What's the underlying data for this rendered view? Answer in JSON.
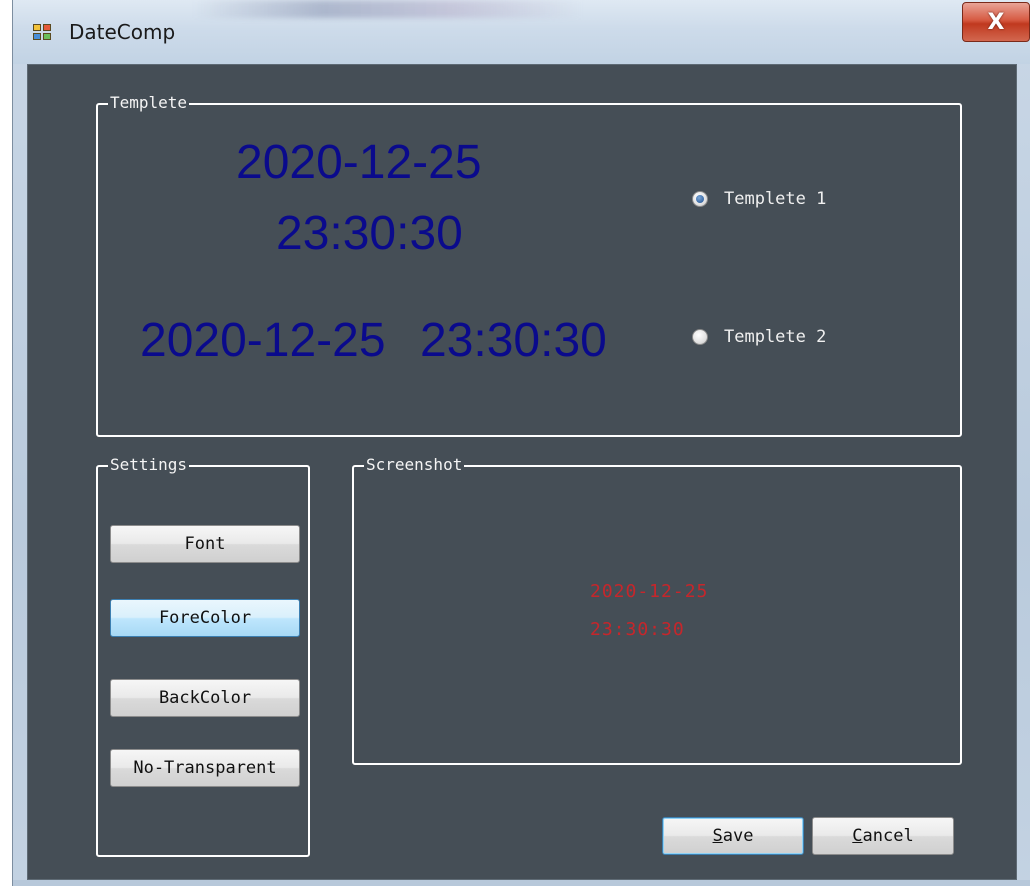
{
  "window": {
    "title": "DateComp",
    "close_glyph": "X"
  },
  "template_group": {
    "label": "Templete",
    "template1": {
      "date": "2020-12-25",
      "time": "23:30:30",
      "radio_label": "Templete 1",
      "checked": true
    },
    "template2": {
      "date": "2020-12-25",
      "time": "23:30:30",
      "radio_label": "Templete 2",
      "checked": false
    },
    "date_color": "#0a0a8c"
  },
  "settings_group": {
    "label": "Settings",
    "buttons": {
      "font": "Font",
      "fore_color": "ForeColor",
      "back_color": "BackColor",
      "no_transparent": "No-Transparent"
    }
  },
  "screenshot_group": {
    "label": "Screenshot",
    "preview_date": "2020-12-25",
    "preview_time": "23:30:30",
    "preview_color": "#c6262b"
  },
  "footer": {
    "save_label": "Save",
    "save_mnemonic": "S",
    "save_rest": "ave",
    "cancel_label": "Cancel",
    "cancel_mnemonic": "C",
    "cancel_rest": "ancel"
  },
  "colors": {
    "client_bg": "#454e56",
    "group_border": "#ffffff"
  },
  "icons": {
    "app": "app-icon",
    "close": "close-icon"
  }
}
